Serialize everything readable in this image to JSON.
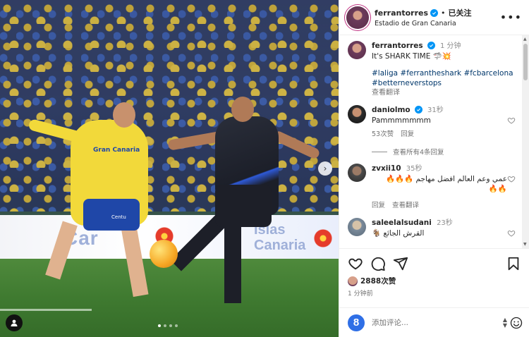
{
  "post": {
    "username": "ferrantorres",
    "follow_status": "已关注",
    "separator": "•",
    "location": "Estadio de Gran Canaria",
    "more_label": "•••",
    "carousel_next": "›",
    "carousel_dots": 4,
    "photo_text": {
      "jersey_yellow": "Gran Canaria",
      "shorts_yellow": "Centu",
      "banner_left": "Car",
      "banner_right": "Islas Canaria"
    }
  },
  "caption": {
    "username": "ferrantorres",
    "time": "1 分钟",
    "text": "It's SHARK TIME 🦈💥",
    "tags": "#laliga #ferrantheshark #fcbarcelona #betterneverstops",
    "translate": "查看翻译"
  },
  "comments": [
    {
      "username": "daniolmo",
      "time": "31秒",
      "text": "Pammmmmmm",
      "likes": "53次赞",
      "reply": "回复",
      "view_replies": "查看所有4条回复"
    },
    {
      "username": "zvxii10",
      "time": "35秒",
      "text": "عمي وعم العالم افضل مهاجم 🔥🔥🔥",
      "text_cont": "🔥🔥",
      "reply": "回复",
      "translate": "查看翻译"
    },
    {
      "username": "saleelalsudani",
      "time": "23秒",
      "text": "🐐 القرش الجائع"
    }
  ],
  "stats": {
    "likes": "2888次赞",
    "posted": "1 分钟前"
  },
  "composer": {
    "placeholder": "添加评论...",
    "app_icon": "8",
    "spin_up": "▲",
    "spin_down": "▼"
  },
  "scrollbar": {
    "up": "▲",
    "down": "▼"
  },
  "icons": [
    "verified-icon",
    "more-icon",
    "heart-icon",
    "comment-icon",
    "share-icon",
    "bookmark-icon",
    "emoji-icon",
    "user-tag-icon",
    "chevron-right-icon"
  ],
  "colors": {
    "link": "#00376b",
    "verified": "#0095f6",
    "muted": "#737373",
    "text": "#262626"
  }
}
